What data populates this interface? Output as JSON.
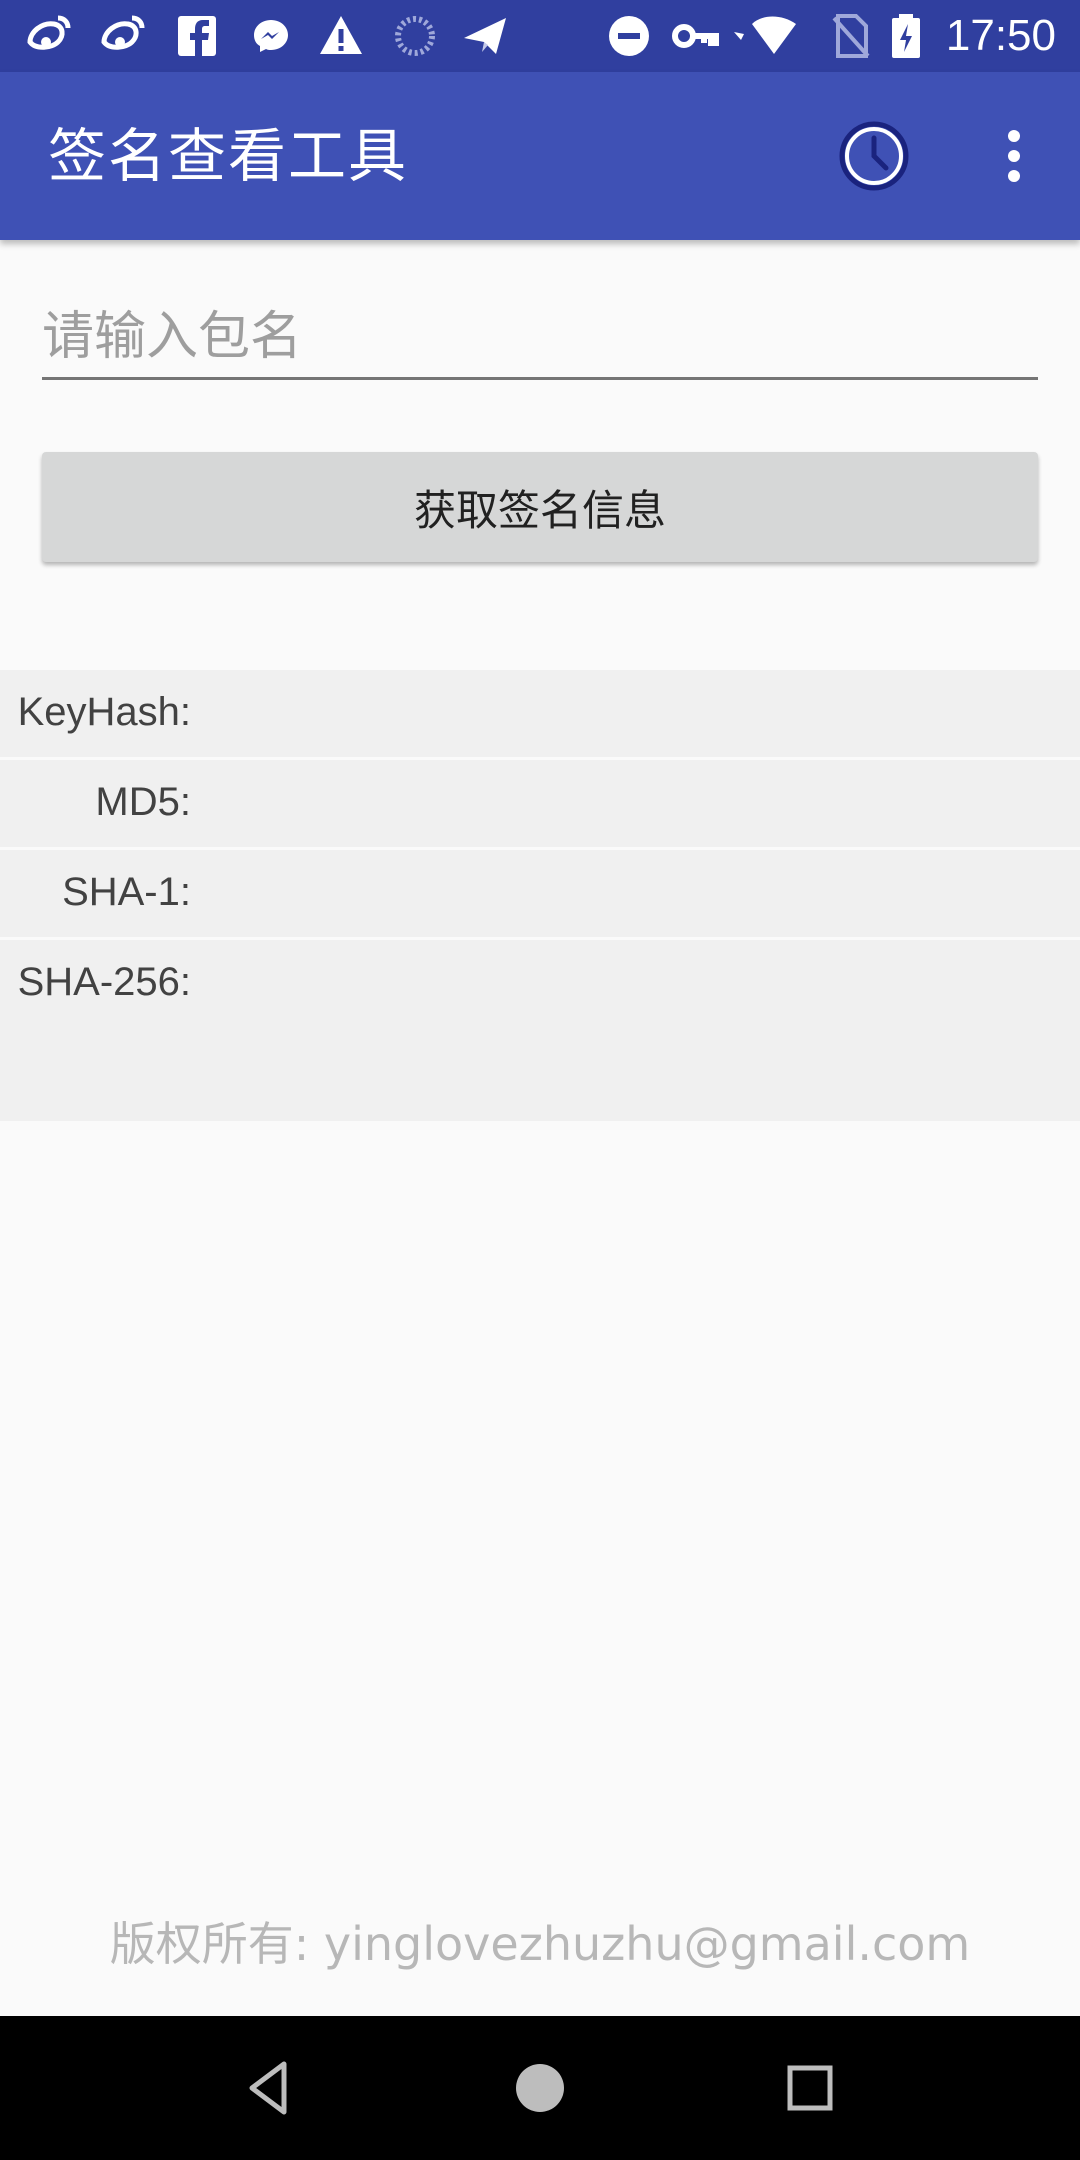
{
  "status_bar": {
    "time": "17:50",
    "left_icons": [
      "weibo-icon",
      "weibo-icon",
      "facebook-icon",
      "messenger-icon",
      "warning-icon",
      "loading-icon",
      "send-icon"
    ],
    "right_icons": [
      "do-not-disturb-icon",
      "vpn-key-icon",
      "wifi-icon",
      "no-sim-icon",
      "battery-charging-icon"
    ]
  },
  "app_bar": {
    "title": "签名查看工具",
    "color": "#3f51b5",
    "history_icon": "history-clock-icon",
    "menu_icon": "more-vert-icon"
  },
  "form": {
    "package_placeholder": "请输入包名",
    "package_value": "",
    "submit_label": "获取签名信息"
  },
  "results": [
    {
      "key": "keyhash",
      "label": "KeyHash:",
      "value": ""
    },
    {
      "key": "md5",
      "label": "MD5:",
      "value": ""
    },
    {
      "key": "sha1",
      "label": "SHA-1:",
      "value": ""
    },
    {
      "key": "sha256",
      "label": "SHA-256:",
      "value": ""
    }
  ],
  "footer": {
    "copyright": "版权所有: yinglovezhuzhu@gmail.com"
  },
  "nav_bar": {
    "back_icon": "back-triangle-icon",
    "home_icon": "home-circle-icon",
    "recents_icon": "recents-square-icon"
  }
}
